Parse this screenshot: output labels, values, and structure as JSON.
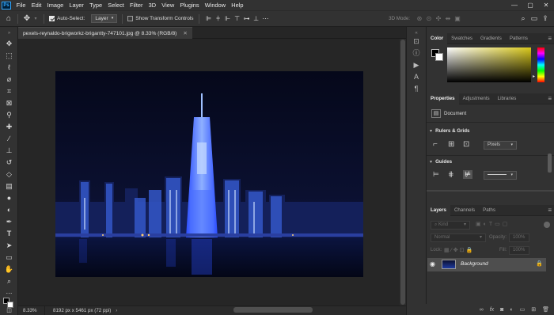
{
  "menubar": {
    "logo": "Ps",
    "items": [
      "File",
      "Edit",
      "Image",
      "Layer",
      "Type",
      "Select",
      "Filter",
      "3D",
      "View",
      "Plugins",
      "Window",
      "Help"
    ],
    "window_controls": [
      "—",
      "▢",
      "✕"
    ]
  },
  "options": {
    "auto_select_label": "Auto-Select:",
    "auto_select_target": "Layer",
    "transform_label": "Show Transform Controls",
    "mode_label": "3D Mode:"
  },
  "document": {
    "tab_title": "pexels-reynaldo-brigworkz-brigantty-747101.jpg @ 8.33% (RGB/8)",
    "tab_close": "✕",
    "zoom": "8.33%",
    "size_info": "8192 px x 5461 px (72 ppi)"
  },
  "panels": {
    "top_tabs": [
      "Color",
      "Swatches",
      "Gradients",
      "Patterns"
    ],
    "mid_tabs": [
      "Properties",
      "Adjustments",
      "Libraries"
    ],
    "document_label": "Document",
    "rulers_label": "Rulers & Grids",
    "units": "Pixels",
    "guides_label": "Guides",
    "layer_tabs": [
      "Layers",
      "Channels",
      "Paths"
    ],
    "kind_label": "Kind",
    "blend_mode": "Normal",
    "opacity_label": "Opacity:",
    "opacity_value": "100%",
    "lock_label": "Lock:",
    "fill_label": "Fill:",
    "fill_value": "100%",
    "layer_name": "Background"
  },
  "colors": {
    "accent": "#31a8ff",
    "photo_sky": "#0b1030",
    "city_glow": "#3a66ff"
  },
  "icons": [
    "move-icon",
    "marquee-icon",
    "lasso-icon",
    "quick-select-icon",
    "crop-icon",
    "frame-icon",
    "eyedropper-icon",
    "healing-icon",
    "brush-icon",
    "stamp-icon",
    "history-brush-icon",
    "eraser-icon",
    "gradient-icon",
    "blur-icon",
    "dodge-icon",
    "pen-icon",
    "type-icon",
    "path-select-icon",
    "rectangle-icon",
    "hand-icon",
    "zoom-icon"
  ]
}
